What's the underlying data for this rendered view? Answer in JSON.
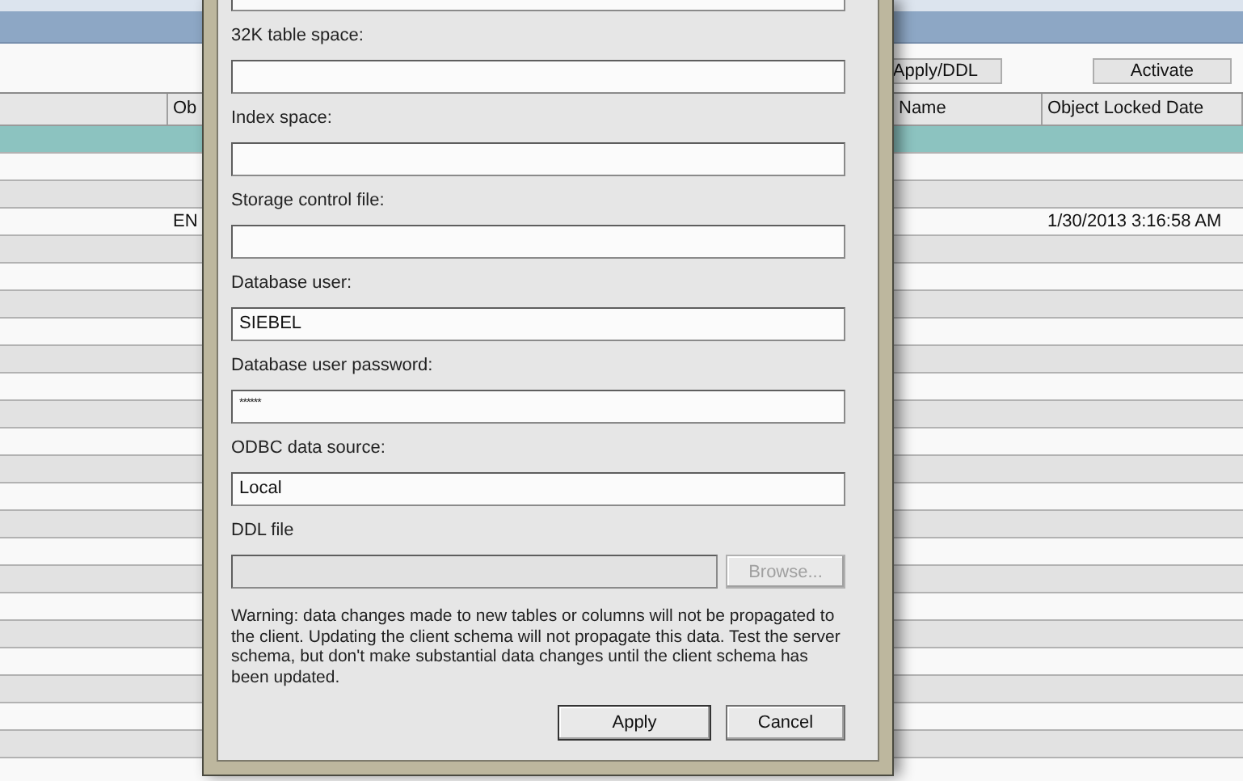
{
  "toolbar": {
    "buttons": [
      {
        "label": "Apply/DDL"
      },
      {
        "label": "Activate"
      }
    ]
  },
  "table": {
    "columns": [
      {
        "label": "Ob"
      },
      {
        "label": "Name"
      },
      {
        "label": "Object Locked Date"
      }
    ],
    "rows": [
      {
        "selected": true
      },
      {
        "selected": false
      },
      {
        "selected": false
      },
      {
        "selected": false,
        "ob": "EN",
        "object_locked_date": "1/30/2013 3:16:58 AM"
      },
      {
        "selected": false
      },
      {
        "selected": false
      },
      {
        "selected": false
      },
      {
        "selected": false
      },
      {
        "selected": false
      },
      {
        "selected": false
      },
      {
        "selected": false
      },
      {
        "selected": false
      },
      {
        "selected": false
      },
      {
        "selected": false
      },
      {
        "selected": false
      },
      {
        "selected": false
      },
      {
        "selected": false
      },
      {
        "selected": false
      },
      {
        "selected": false
      },
      {
        "selected": false
      },
      {
        "selected": false
      },
      {
        "selected": false
      },
      {
        "selected": false
      },
      {
        "selected": false
      }
    ]
  },
  "dialog": {
    "fields": [
      {
        "kind": "cut"
      },
      {
        "kind": "text",
        "label": "32K table space:"
      },
      {
        "kind": "text",
        "label": "Index space:"
      },
      {
        "kind": "text",
        "label": "Storage control file:"
      },
      {
        "kind": "text",
        "label": "Database user:",
        "value": "SIEBEL"
      },
      {
        "kind": "password",
        "label": "Database user password:",
        "value": "******"
      },
      {
        "kind": "text",
        "label": "ODBC data source:",
        "value": "Local"
      },
      {
        "kind": "file",
        "label": "DDL file",
        "disabled": true,
        "button": "Browse..."
      }
    ],
    "warning": "Warning: data changes made to new tables or columns will not be propagated to the client.  Updating the client schema will not propagate this data. Test the server schema, but don't make substantial data changes until the client schema has been updated.",
    "buttons": [
      {
        "label": "Apply"
      },
      {
        "label": "Cancel"
      }
    ]
  }
}
